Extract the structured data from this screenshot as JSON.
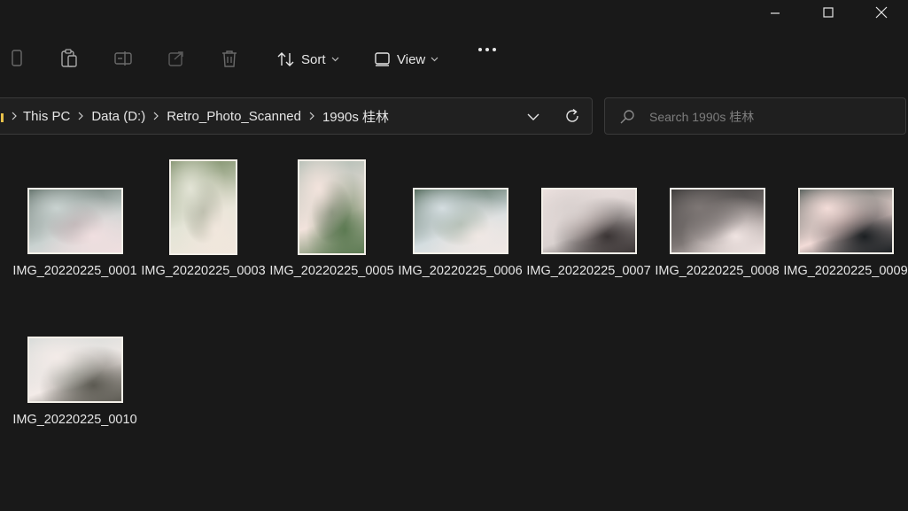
{
  "window": {
    "controls": [
      "minimize-icon",
      "maximize-icon",
      "close-icon"
    ]
  },
  "toolbar": {
    "icons": [
      "phone-icon",
      "clipboard-icon",
      "rename-icon",
      "share-icon",
      "trash-icon"
    ],
    "sort_label": "Sort",
    "view_label": "View",
    "more_icon": "more-icon"
  },
  "address": {
    "crumbs": [
      "This PC",
      "Data (D:)",
      "Retro_Photo_Scanned",
      "1990s 桂林"
    ]
  },
  "search": {
    "placeholder": "Search 1990s 桂林"
  },
  "files": [
    {
      "name": "IMG_20220225_0001",
      "orientation": "landscape",
      "palette": [
        "#4a5a52",
        "#c9d2d0",
        "#f0dfe0",
        "#8a6a70"
      ]
    },
    {
      "name": "IMG_20220225_0003",
      "orientation": "portrait",
      "palette": [
        "#6e8158",
        "#e3e4d6",
        "#f1e7dd",
        "#4f5b40"
      ]
    },
    {
      "name": "IMG_20220225_0005",
      "orientation": "portrait",
      "palette": [
        "#a7b7ae",
        "#f2e3dc",
        "#5c7a52",
        "#3b4c3a"
      ]
    },
    {
      "name": "IMG_20220225_0006",
      "orientation": "landscape",
      "palette": [
        "#2f4a36",
        "#d4dde0",
        "#f0e8e4",
        "#4b6b4a"
      ]
    },
    {
      "name": "IMG_20220225_0007",
      "orientation": "landscape",
      "palette": [
        "#f2e6e4",
        "#d9d1cf",
        "#3a3434",
        "#eedad6"
      ]
    },
    {
      "name": "IMG_20220225_0008",
      "orientation": "landscape",
      "palette": [
        "#2a2a2a",
        "#7e7775",
        "#f0e4e2",
        "#4a4646"
      ]
    },
    {
      "name": "IMG_20220225_0009",
      "orientation": "landscape",
      "palette": [
        "#2d3e3a",
        "#f3dcd8",
        "#1b1f22",
        "#c7a6a2"
      ]
    },
    {
      "name": "IMG_20220225_0010",
      "orientation": "landscape",
      "palette": [
        "#cfd6d4",
        "#f3ebe8",
        "#5c5a52",
        "#a7b0a6"
      ]
    }
  ],
  "colors": {
    "background": "#191919",
    "folder": "#e8c14a",
    "text": "#e6e6e6"
  }
}
